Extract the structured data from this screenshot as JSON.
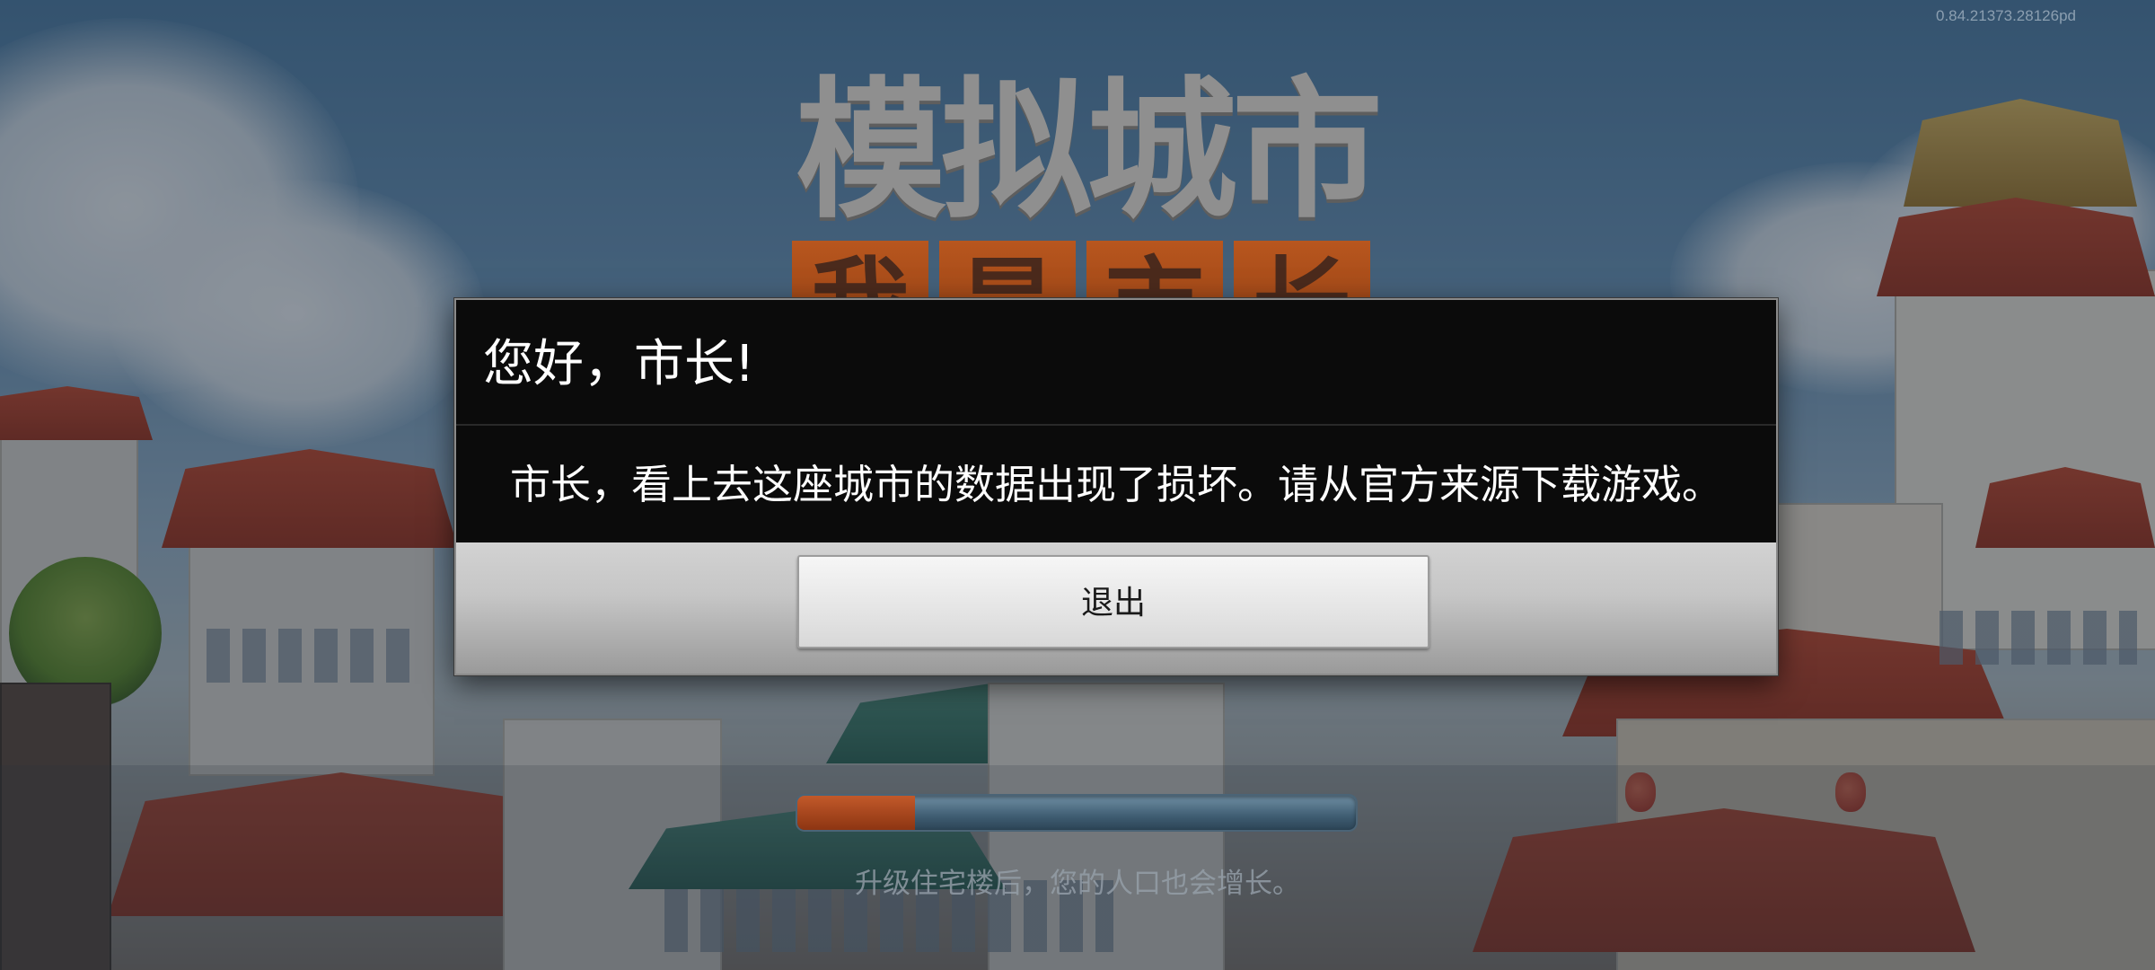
{
  "version": "0.84.21373.28126pd",
  "game": {
    "title": "模拟城市",
    "subtitle_chars": [
      "我",
      "是",
      "市",
      "长"
    ]
  },
  "dialog": {
    "title": "您好，市长!",
    "message": "市长，看上去这座城市的数据出现了损坏。请从官方来源下载游戏。",
    "exit_label": "退出"
  },
  "loading": {
    "progress": 0.21,
    "tip": "升级住宅楼后，您的人口也会增长。"
  },
  "colors": {
    "progress_fill": "#c2592a",
    "dialog_bg": "#0b0b0b",
    "subtitle_bg": "#b8561e"
  }
}
